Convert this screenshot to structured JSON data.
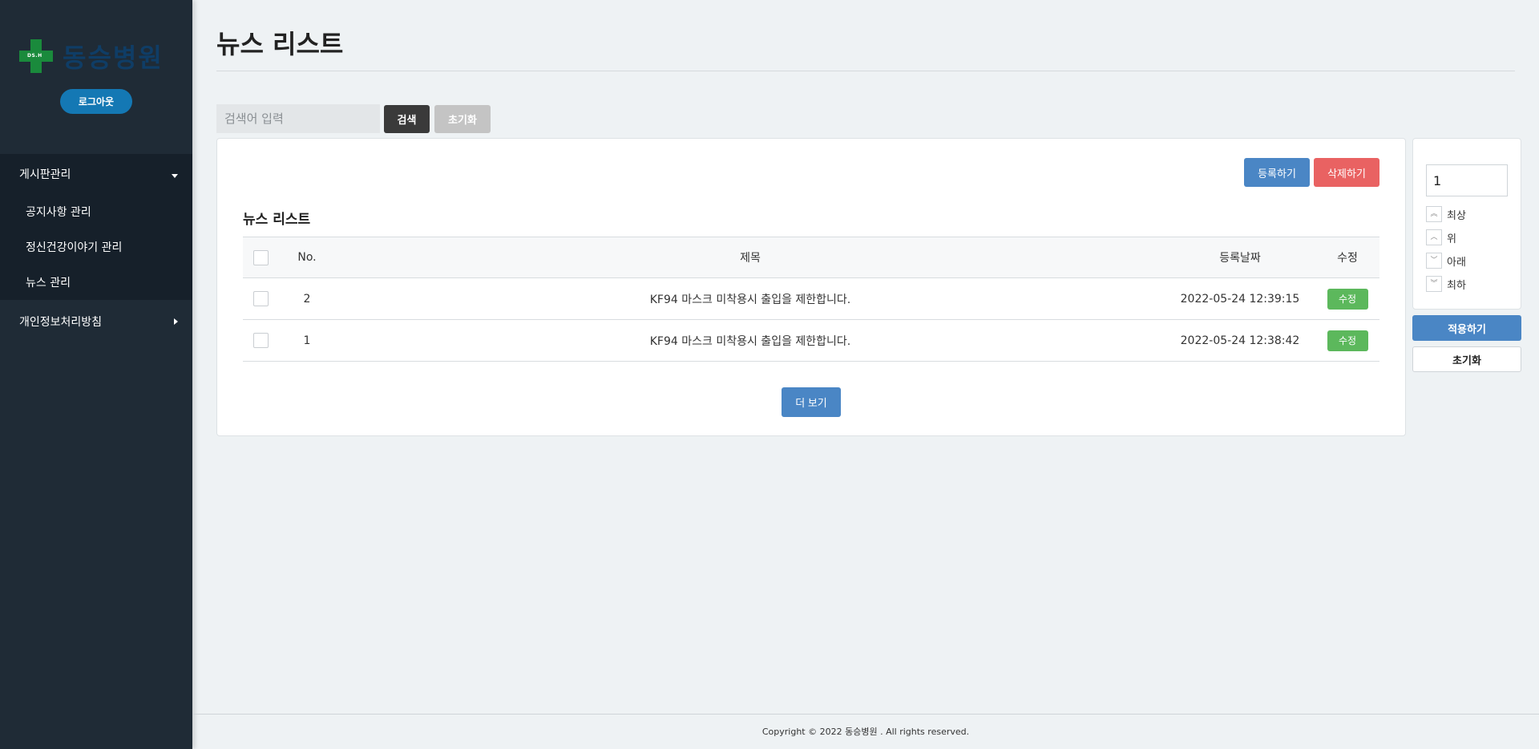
{
  "sidebar": {
    "logo_text": "동승병원",
    "logo_mark": "DS.H",
    "logout_label": "로그아웃",
    "menu_board": "게시판관리",
    "sub_items": [
      "공지사항 관리",
      "정신건강이야기 관리",
      "뉴스 관리"
    ],
    "menu_privacy": "개인정보처리방침"
  },
  "page": {
    "title": "뉴스 리스트"
  },
  "search": {
    "placeholder": "검색어 입력",
    "search_label": "검색",
    "reset_label": "초기화"
  },
  "card": {
    "register_label": "등록하기",
    "delete_label": "삭제하기",
    "list_title": "뉴스 리스트",
    "more_label": "더 보기"
  },
  "table": {
    "headers": {
      "no": "No.",
      "title": "제목",
      "date": "등록날짜",
      "edit": "수정"
    },
    "rows": [
      {
        "no": "2",
        "title": "KF94 마스크 미착용시 출입을 제한합니다.",
        "date": "2022-05-24 12:39:15",
        "edit": "수정"
      },
      {
        "no": "1",
        "title": "KF94 마스크 미착용시 출입을 제한합니다.",
        "date": "2022-05-24 12:38:42",
        "edit": "수정"
      }
    ]
  },
  "order": {
    "value": "1",
    "top_label": "최상",
    "up_label": "위",
    "down_label": "아래",
    "bottom_label": "최하",
    "apply_label": "적용하기",
    "reset_label": "초기화"
  },
  "footer": {
    "text": "Copyright © 2022 동승병원 . All rights reserved."
  },
  "colors": {
    "sidebar_bg": "#1f2b36",
    "primary": "#4a86c5",
    "danger": "#e96262",
    "success": "#5cb85c"
  }
}
